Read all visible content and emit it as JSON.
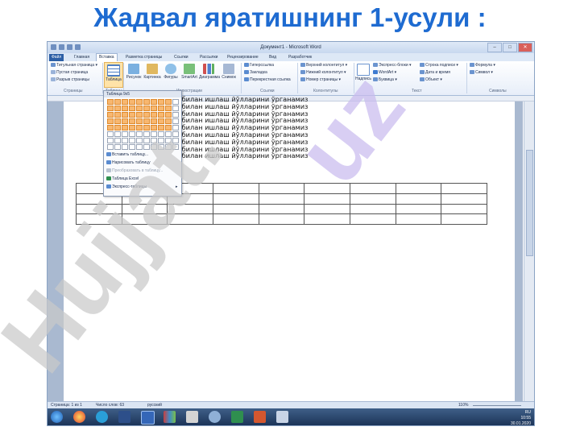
{
  "slide": {
    "title": "Жадвал яратишнинг 1-усули :"
  },
  "window": {
    "title": "Документ1 - Microsoft Word",
    "buttons": [
      "–",
      "□",
      "✕"
    ]
  },
  "tabs": [
    "Файл",
    "Главная",
    "Вставка",
    "Разметка страницы",
    "Ссылки",
    "Рассылки",
    "Рецензирование",
    "Вид",
    "Разработчик"
  ],
  "active_tab": "Вставка",
  "ribbon": {
    "pages_group": {
      "name": "Страницы",
      "items": [
        "Титульная страница ▾",
        "Пустая страница",
        "Разрыв страницы"
      ]
    },
    "tables_group": {
      "name": "Таблицы",
      "button": "Таблица"
    },
    "illustrations_group": {
      "name": "Иллюстрации",
      "buttons": [
        "Рисунок",
        "Картинка",
        "Фигуры",
        "SmartArt",
        "Диаграмма",
        "Снимок"
      ]
    },
    "links_group": {
      "name": "Ссылки",
      "items": [
        "Гиперссылка",
        "Закладка",
        "Перекрестная ссылка"
      ]
    },
    "header_group": {
      "name": "Колонтитулы",
      "items": [
        "Верхний колонтитул ▾",
        "Нижний колонтитул ▾",
        "Номер страницы ▾"
      ]
    },
    "text_group": {
      "name": "Текст",
      "items": [
        "Экспресс-блоки ▾",
        "WordArt ▾",
        "Буквица ▾",
        "Строка подписи ▾",
        "Дата и время",
        "Объект ▾"
      ],
      "button": "Надпись"
    },
    "symbols_group": {
      "name": "Символы",
      "items": [
        "Формула ▾",
        "Символ ▾"
      ]
    }
  },
  "table_dropdown": {
    "header": "Таблица 9x5",
    "items": [
      "Вставить таблицу...",
      "Нарисовать таблицу",
      "Преобразовать в таблицу...",
      "Таблица Excel",
      "Экспресс-таблицы"
    ]
  },
  "document": {
    "lines": [
      "Биз жадвал билан ишлаш йўлларини ўрганамиз",
      "Биз жадвал билан ишлаш йўлларини ўрганамиз",
      "Биз жадвал билан ишлаш йўлларини ўрганамиз",
      "Биз жадвал билан ишлаш йўлларини ўрганамиз",
      "Биз жадвал билан ишлаш йўлларини ўрганамиз",
      "Биз жадвал билан ишлаш йўлларини ўрганамиз",
      "Биз жадвал билан ишлаш йўлларини ўрганамиз",
      "Биз жадвал билан ишлаш йўлларини ўрганамиз",
      "Биз жадвал билан ишлаш йўлларини ўрганамиз"
    ],
    "table": {
      "rows": 4,
      "cols": 9
    }
  },
  "status": {
    "page": "Страница: 1 из 1",
    "words": "Число слов: 63",
    "lang": "русский",
    "zoom": "110%"
  },
  "tray": {
    "lang": "RU",
    "time": "10:55",
    "date": "30.01.2020"
  },
  "watermark": {
    "text1": "Hujjat.",
    "text2": "uz"
  },
  "colors": {
    "title": "#1e6bd1",
    "highlight": "#f7b770",
    "watermark": "#c9c9c9",
    "watermark_accent": "#c7b9ee"
  }
}
